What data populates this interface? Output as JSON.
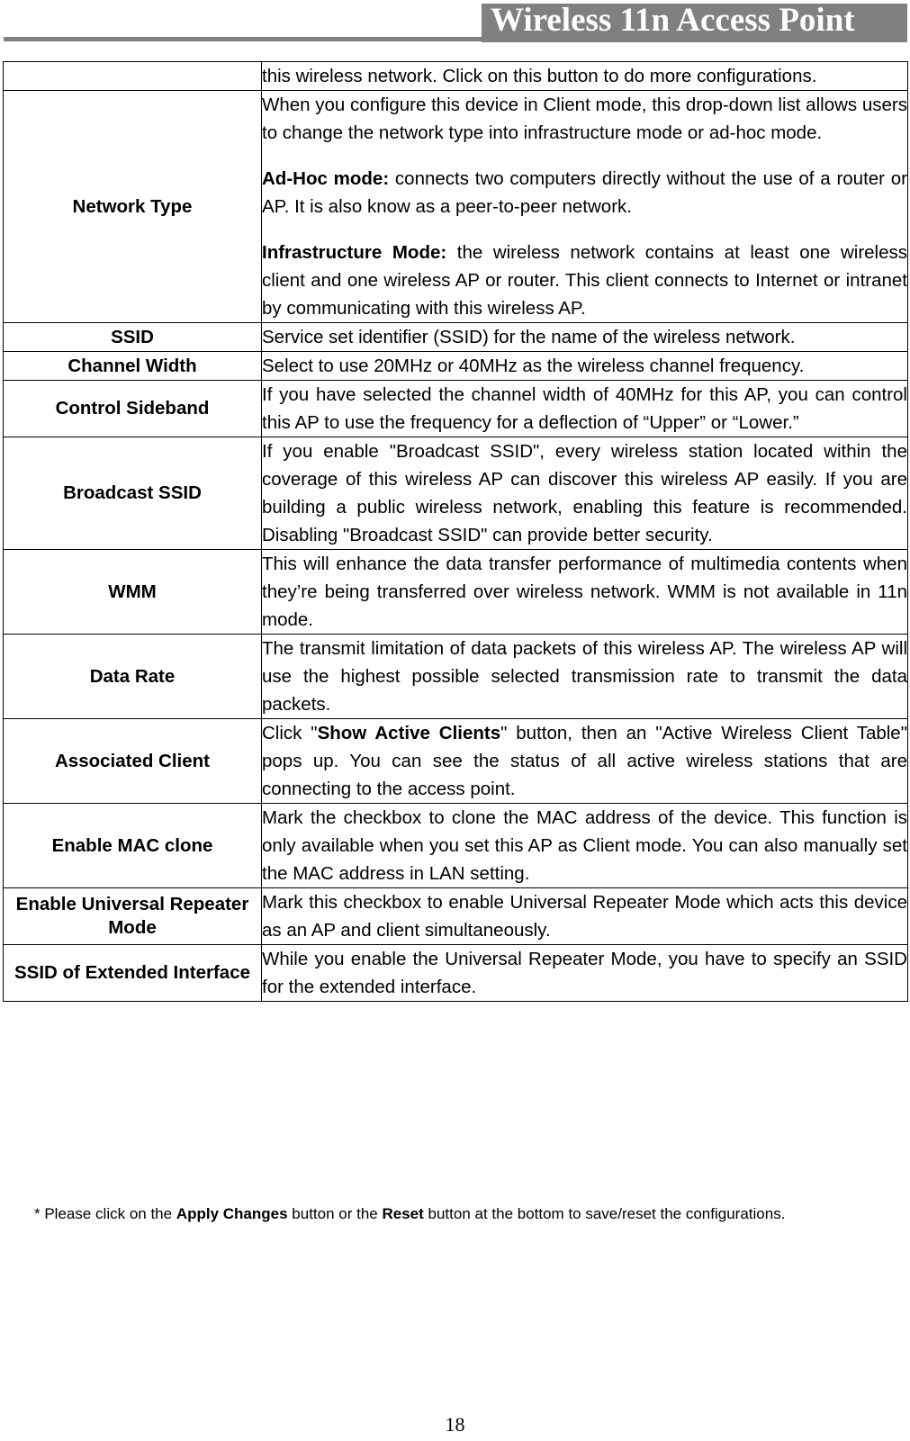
{
  "header": {
    "title": "Wireless 11n Access Point",
    "band_color": "#808080",
    "title_color": "#ffffff"
  },
  "table": {
    "columns": [
      "",
      ""
    ],
    "rows": [
      {
        "label": "",
        "paragraphs": [
          {
            "text": "this wireless network. Click on this button to do more configurations.",
            "justify": true
          }
        ]
      },
      {
        "label": "Network Type",
        "paragraphs": [
          {
            "text": "When you configure this device in Client mode, this drop-down list allows users to change the network type into infrastructure mode or ad-hoc mode.",
            "justify": true
          },
          {
            "bold_lead": "Ad-Hoc mode:",
            "text": " connects two computers directly without the use of a router or AP.    It is also know as a peer-to-peer network.",
            "justify": true
          },
          {
            "bold_lead": "Infrastructure Mode:",
            "text": " the wireless network contains at least one wireless client and one wireless AP or router. This client connects to Internet or intranet by communicating with this wireless AP.",
            "justify": true
          }
        ]
      },
      {
        "label": "SSID",
        "paragraphs": [
          {
            "text": "Service set identifier (SSID) for the name of the wireless network.",
            "justify": false
          }
        ]
      },
      {
        "label": "Channel Width",
        "paragraphs": [
          {
            "text": "Select to use 20MHz or 40MHz as the wireless channel frequency.",
            "justify": false
          }
        ]
      },
      {
        "label": "Control Sideband",
        "paragraphs": [
          {
            "text": "If you have selected the channel width of 40MHz for this AP, you can control this AP to use the frequency for a deflection of “Upper” or “Lower.”",
            "justify": true
          }
        ]
      },
      {
        "label": "Broadcast SSID",
        "paragraphs": [
          {
            "text": "If you enable \"Broadcast SSID\", every wireless station located within the coverage of this wireless AP can discover this wireless AP easily. If you are building a public wireless network, enabling this feature is recommended. Disabling \"Broadcast SSID\" can provide better security.",
            "justify": true
          }
        ]
      },
      {
        "label": "WMM",
        "paragraphs": [
          {
            "text": "This will enhance the data transfer performance of multimedia contents when they’re being transferred over wireless network. WMM is not available in 11n mode.",
            "justify": true
          }
        ]
      },
      {
        "label": "Data Rate",
        "paragraphs": [
          {
            "text": "The transmit limitation of data packets of this wireless AP. The wireless AP will use the highest possible selected transmission rate to transmit the data packets.",
            "justify": true
          }
        ]
      },
      {
        "label": "Associated Client",
        "paragraphs": [
          {
            "text_pre": "Click \"",
            "bold_mid": "Show Active Clients",
            "text": "\" button, then an \"Active Wireless Client Table\" pops up. You can see the status of all active wireless stations that are connecting to the access point.",
            "justify": true
          }
        ]
      },
      {
        "label": "Enable MAC clone",
        "paragraphs": [
          {
            "text": "Mark the checkbox to clone the MAC address of the device. This function is only available when you set this AP as Client mode. You can also manually set the MAC address in LAN setting.",
            "justify": true
          }
        ]
      },
      {
        "label": "Enable Universal Repeater Mode",
        "paragraphs": [
          {
            "text": "Mark this checkbox to enable Universal Repeater Mode which acts this device as an AP and client simultaneously.",
            "justify": true
          }
        ]
      },
      {
        "label": "SSID of Extended Interface",
        "paragraphs": [
          {
            "text": "While you enable the Universal Repeater Mode, you have to specify an SSID for the extended interface.",
            "justify": true
          }
        ]
      }
    ]
  },
  "footnote": {
    "prefix": "* Please click on the ",
    "bold1": "Apply Changes",
    "middle": " button or the ",
    "bold2": "Reset",
    "suffix": " button at the bottom to save/reset the configurations."
  },
  "page_number": "18"
}
